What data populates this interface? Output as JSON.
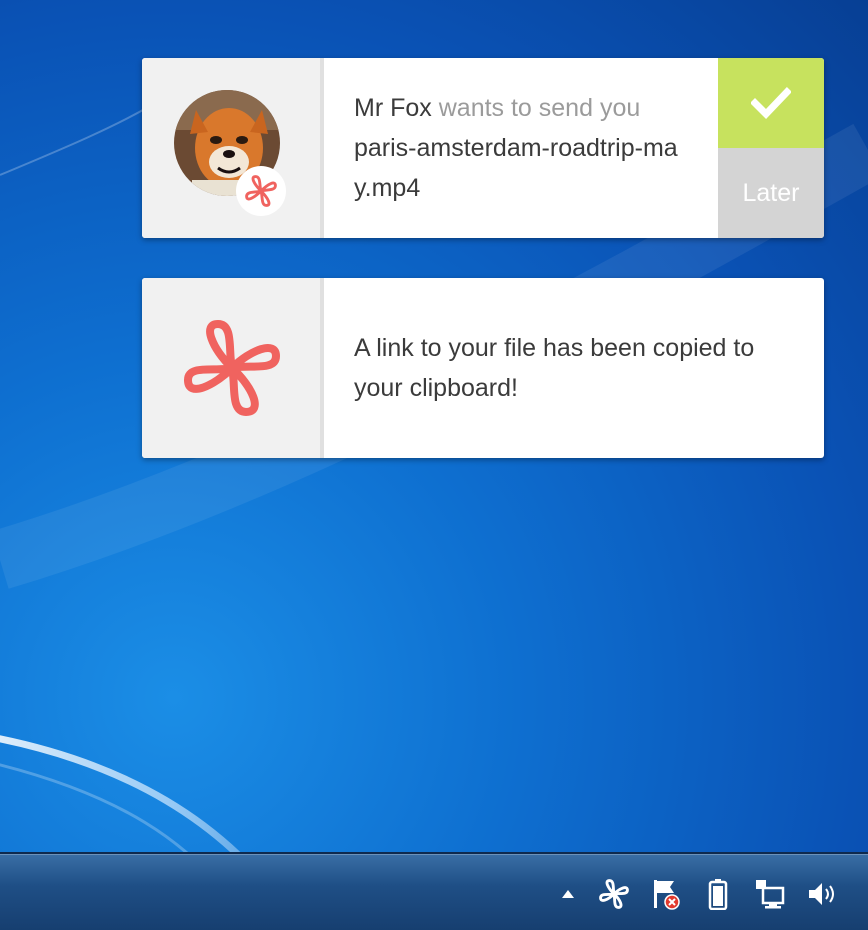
{
  "notification_transfer": {
    "sender": "Mr Fox",
    "action_text": "wants to send you",
    "filename": "paris-amsterdam-roadtrip-may.mp4",
    "accept_icon": "checkmark-icon",
    "later_label": "Later"
  },
  "notification_clipboard": {
    "message": "A link to your file has been copied to your clipboard!",
    "icon": "app-logo-icon"
  },
  "taskbar": {
    "tray_icons": [
      "show-hidden-icons-arrow",
      "app-logo-icon",
      "action-center-flag-icon",
      "battery-icon",
      "network-icon",
      "volume-icon"
    ]
  },
  "colors": {
    "accept": "#c7e25e",
    "later": "#d4d4d4",
    "brand": "#f0635f",
    "muted_text": "#9b9b9b",
    "text": "#3b3b3b"
  }
}
